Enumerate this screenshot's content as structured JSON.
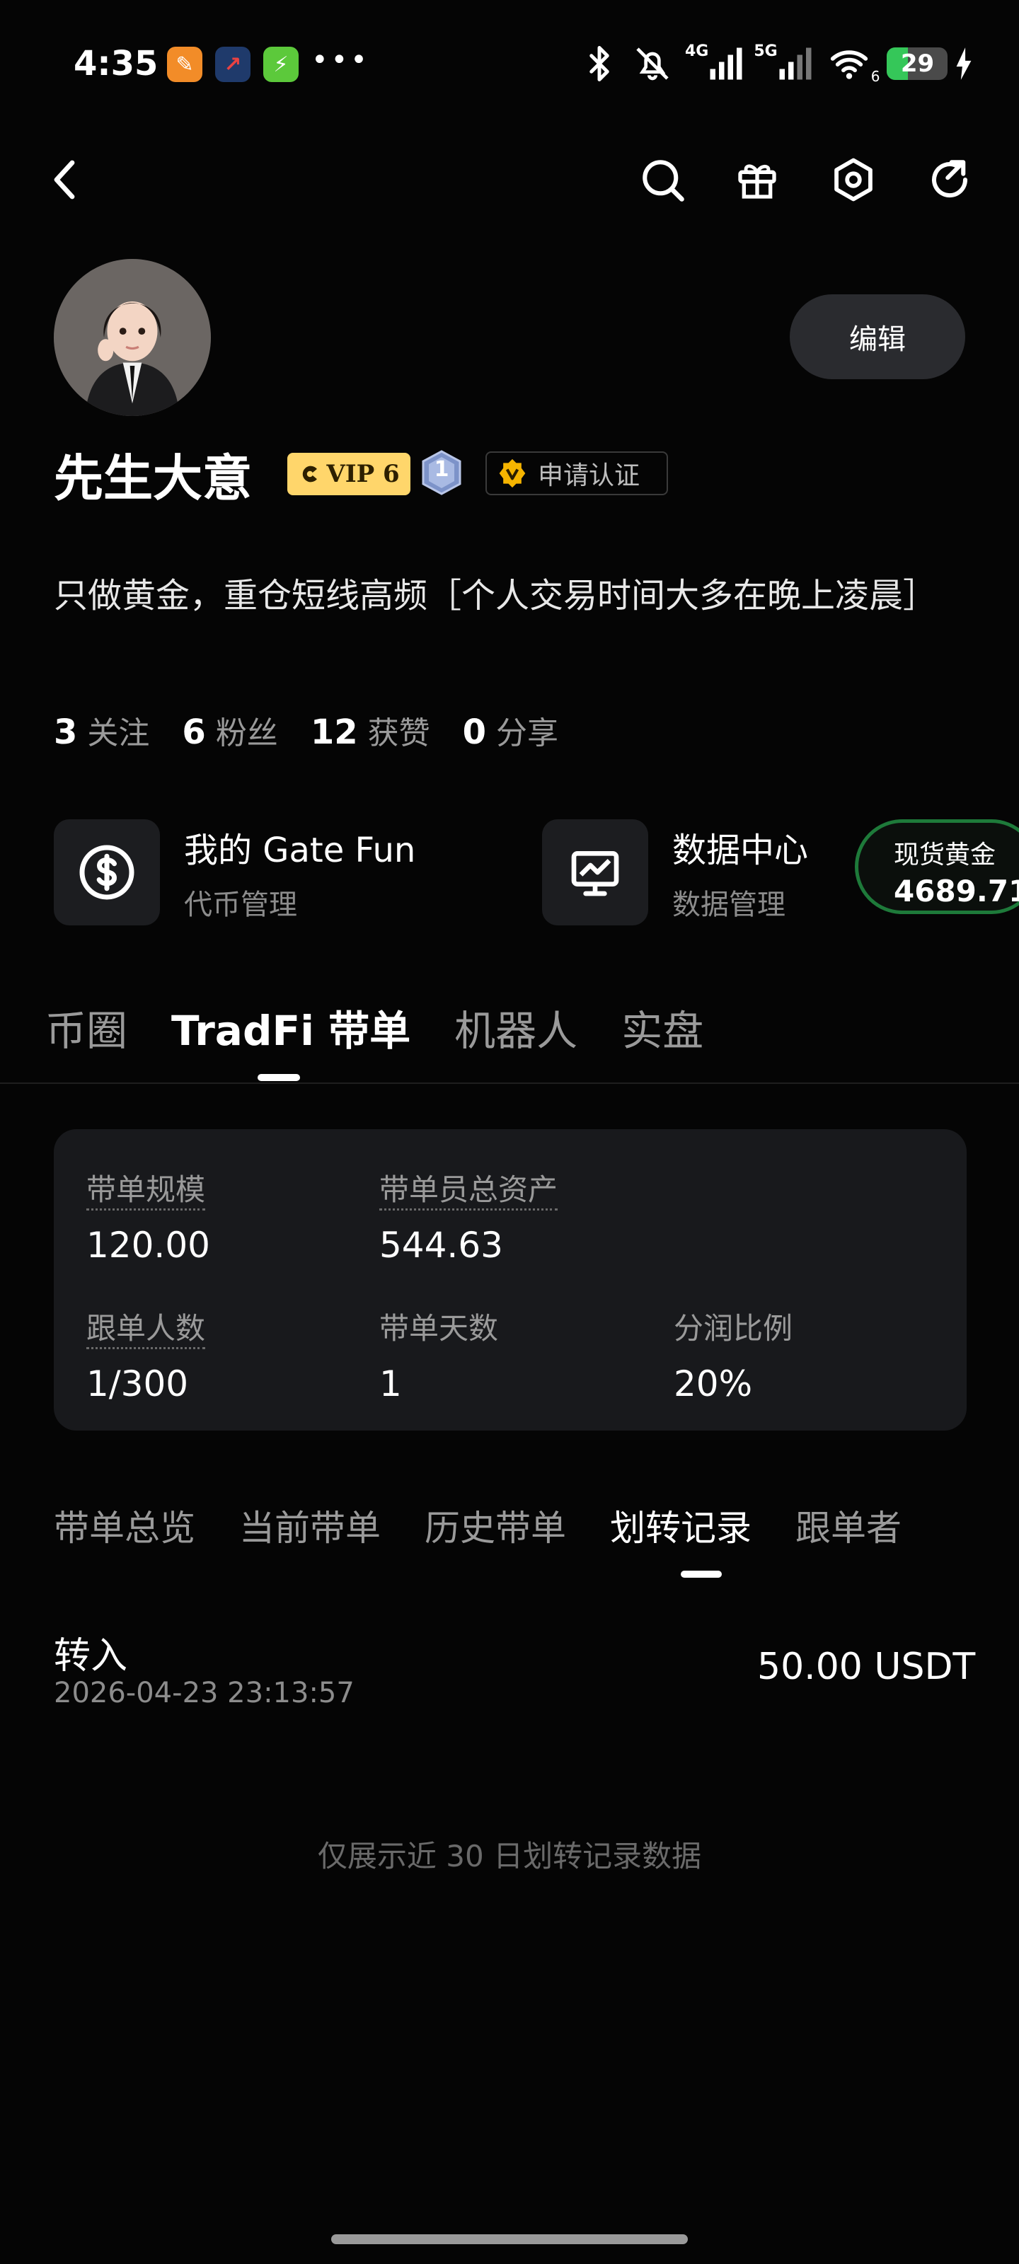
{
  "status_bar": {
    "time": "4:35",
    "dots": "•••",
    "battery": "29",
    "net_4g": "4G",
    "net_5g": "5G",
    "wifi_sub": "6"
  },
  "profile": {
    "name": "先生大意",
    "vip_label": "VIP 6",
    "level": "1",
    "verify_label": "申请认证",
    "edit_label": "编辑",
    "bio": "只做黄金，重仓短线高频［个人交易时间大多在晚上凌晨］",
    "stats": [
      {
        "num": "3",
        "label": "关注"
      },
      {
        "num": "6",
        "label": "粉丝"
      },
      {
        "num": "12",
        "label": "获赞"
      },
      {
        "num": "0",
        "label": "分享"
      }
    ]
  },
  "features": [
    {
      "title": "我的 Gate Fun",
      "sub": "代币管理",
      "icon": "dollar-circle-icon"
    },
    {
      "title": "数据中心",
      "sub": "数据管理",
      "icon": "chart-monitor-icon"
    }
  ],
  "gold_ticker": {
    "label": "现货黄金",
    "price": "4689.71"
  },
  "main_tabs": [
    "币圈",
    "TradFi 带单",
    "机器人",
    "实盘"
  ],
  "summary": {
    "row1": [
      {
        "label": "带单规模",
        "value": "120.00"
      },
      {
        "label": "带单员总资产",
        "value": "544.63"
      }
    ],
    "row2": [
      {
        "label": "跟单人数",
        "value": "1/300"
      },
      {
        "label": "带单天数",
        "value": "1"
      },
      {
        "label": "分润比例",
        "value": "20%"
      }
    ]
  },
  "sub_tabs": [
    "带单总览",
    "当前带单",
    "历史带单",
    "划转记录",
    "跟单者"
  ],
  "record": {
    "type": "转入",
    "time": "2026-04-23 23:13:57",
    "amount": "50.00 USDT"
  },
  "note": "仅展示近 30 日划转记录数据",
  "colors": {
    "background": "#050505",
    "card": "#18191c",
    "vip_gold": "#ffd66b",
    "ticker_border": "#1e7a3a",
    "battery_green": "#35c759"
  }
}
